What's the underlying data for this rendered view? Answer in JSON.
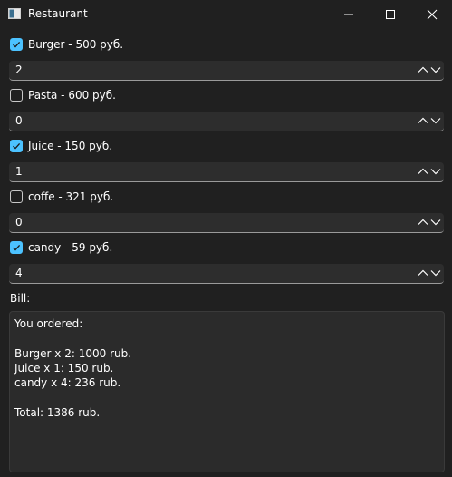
{
  "window": {
    "title": "Restaurant",
    "icon": "app-window-icon"
  },
  "items": [
    {
      "label": "Burger - 500 руб.",
      "checked": true,
      "quantity": "2"
    },
    {
      "label": "Pasta - 600 руб.",
      "checked": false,
      "quantity": "0"
    },
    {
      "label": "Juice - 150 руб.",
      "checked": true,
      "quantity": "1"
    },
    {
      "label": "coffe - 321 руб.",
      "checked": false,
      "quantity": "0"
    },
    {
      "label": "candy - 59 руб.",
      "checked": true,
      "quantity": "4"
    }
  ],
  "bill": {
    "label": "Bill:",
    "lines": [
      "You ordered:",
      "",
      "Burger x 2: 1000 rub.",
      "Juice x 1: 150 rub.",
      "candy x 4: 236 rub.",
      "",
      "Total: 1386 rub."
    ]
  },
  "colors": {
    "background": "#202020",
    "accent": "#4cc2ff",
    "field": "#2d2d2d"
  }
}
